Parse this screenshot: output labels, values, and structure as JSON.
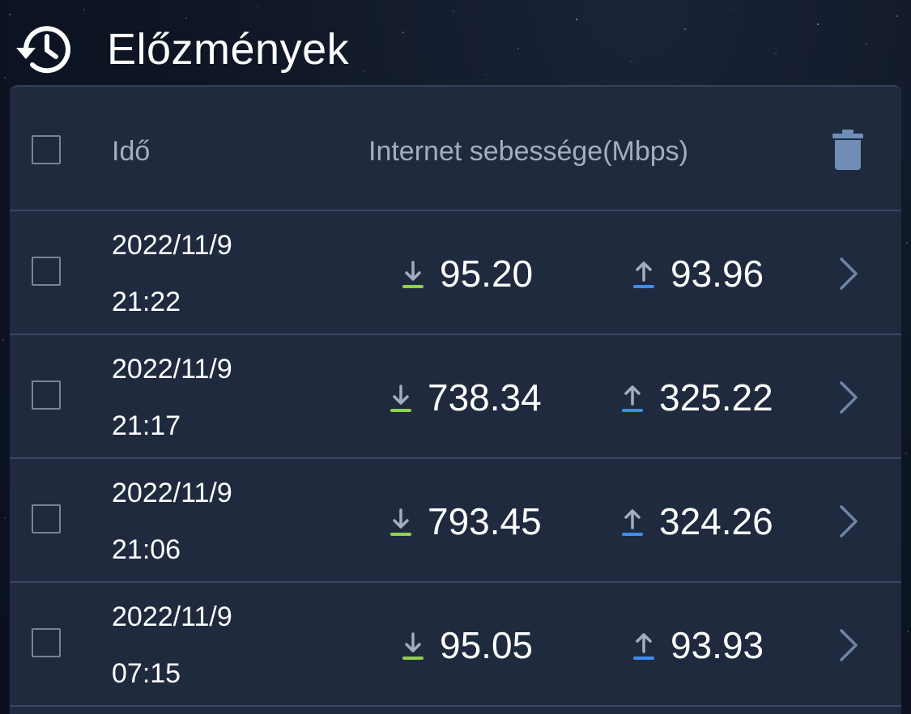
{
  "header": {
    "title": "Előzmények",
    "icon": "history-icon"
  },
  "table": {
    "columns": {
      "time": "Idő",
      "speed": "Internet sebessége(Mbps)"
    },
    "rows": [
      {
        "date": "2022/11/9",
        "time": "21:22",
        "download": "95.20",
        "upload": "93.96"
      },
      {
        "date": "2022/11/9",
        "time": "21:17",
        "download": "738.34",
        "upload": "325.22"
      },
      {
        "date": "2022/11/9",
        "time": "21:06",
        "download": "793.45",
        "upload": "324.26"
      },
      {
        "date": "2022/11/9",
        "time": "07:15",
        "download": "95.05",
        "upload": "93.93"
      }
    ]
  },
  "colors": {
    "panel": "#1f2a3f",
    "download_accent": "#8fd14f",
    "upload_accent": "#3d8df0",
    "muted_text": "#a5adbd"
  }
}
